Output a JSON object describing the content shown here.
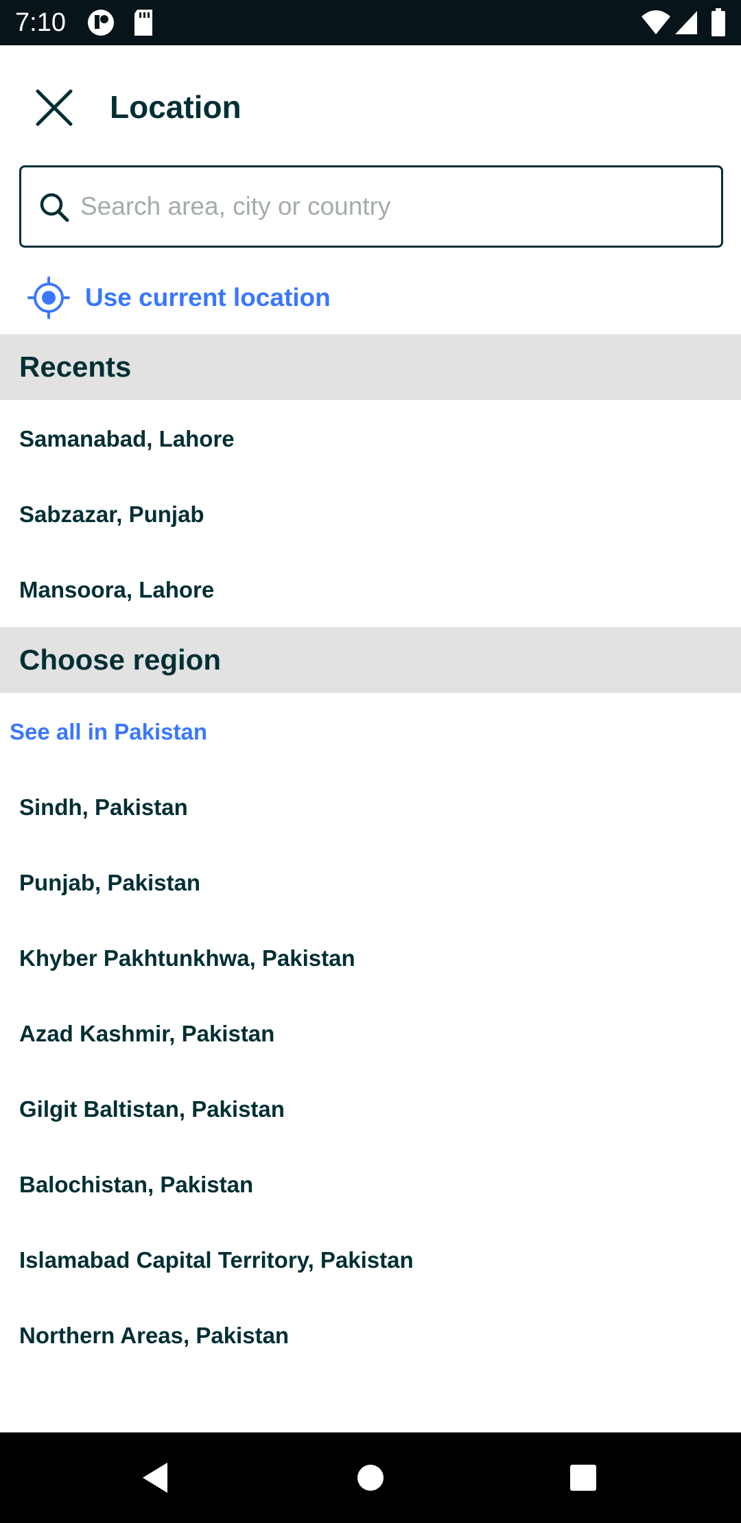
{
  "status_bar": {
    "time": "7:10"
  },
  "header": {
    "title": "Location"
  },
  "search": {
    "placeholder": "Search area, city or country",
    "value": ""
  },
  "current_location": {
    "label": "Use current location"
  },
  "recents": {
    "title": "Recents",
    "items": [
      "Samanabad, Lahore",
      "Sabzazar, Punjab",
      "Mansoora, Lahore"
    ]
  },
  "regions": {
    "title": "Choose region",
    "see_all": "See all in Pakistan",
    "items": [
      "Sindh, Pakistan",
      "Punjab, Pakistan",
      "Khyber Pakhtunkhwa, Pakistan",
      "Azad Kashmir, Pakistan",
      "Gilgit Baltistan, Pakistan",
      "Balochistan, Pakistan",
      "Islamabad Capital Territory, Pakistan",
      "Northern Areas, Pakistan"
    ]
  },
  "colors": {
    "primary_text": "#002f34",
    "accent": "#3a77ff",
    "section_bg": "#e2e2e2"
  }
}
